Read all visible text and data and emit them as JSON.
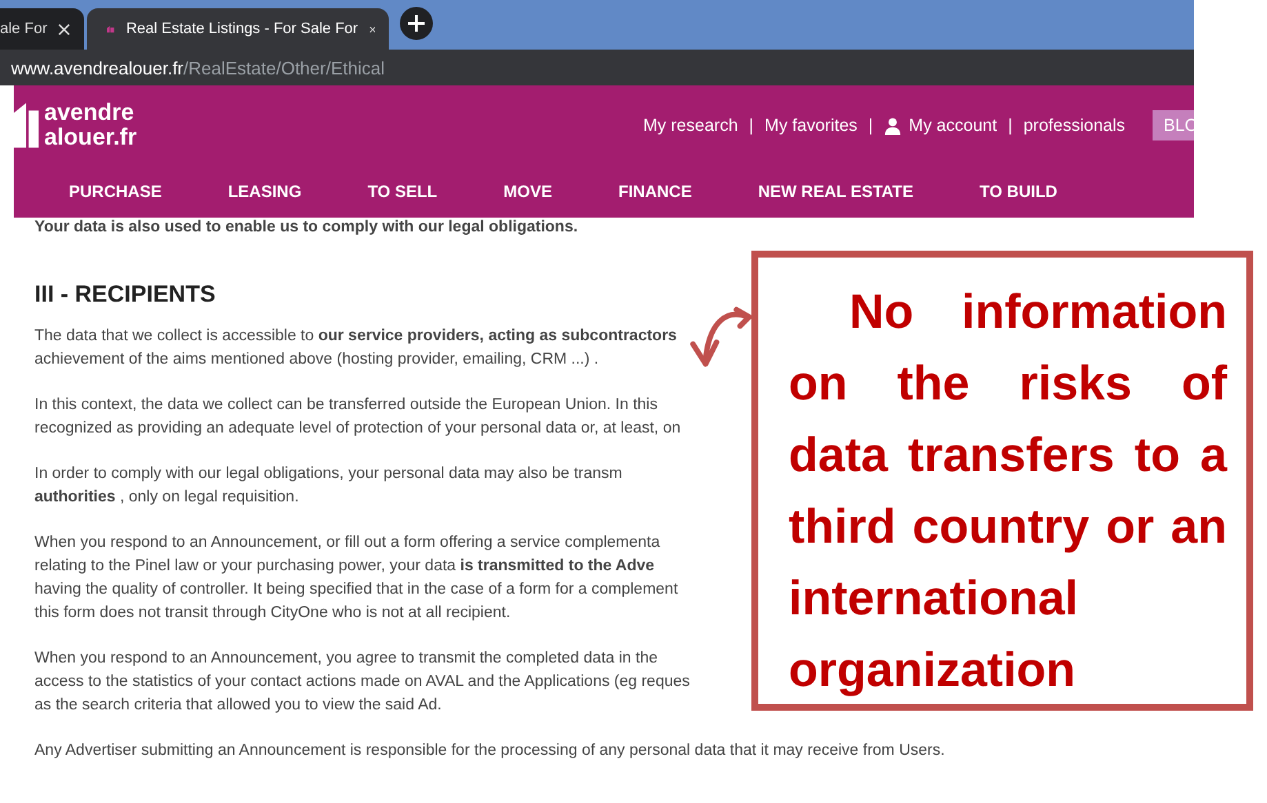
{
  "browser": {
    "tabs": [
      {
        "title": "ale For",
        "selected": false
      },
      {
        "title": "Real Estate Listings - For Sale For",
        "selected": true
      }
    ],
    "url": {
      "host": "www.avendrealouer.fr",
      "path": "/RealEstate/Other/Ethical"
    }
  },
  "header": {
    "logo": [
      "avendre",
      "alouer.fr"
    ],
    "links": [
      {
        "label": "My research",
        "kind": "link"
      },
      {
        "label": "|",
        "kind": "separator"
      },
      {
        "label": "My favorites",
        "kind": "link"
      },
      {
        "label": "|",
        "kind": "separator"
      },
      {
        "label": "My account",
        "kind": "account"
      },
      {
        "label": "|",
        "kind": "separator"
      },
      {
        "label": "professionals",
        "kind": "link"
      }
    ],
    "blog_button": "BLO",
    "nav": [
      "PURCHASE",
      "LEASING",
      "TO SELL",
      "MOVE",
      "FINANCE",
      "NEW REAL ESTATE",
      "TO BUILD"
    ]
  },
  "content": {
    "intro": "Your data is also used to enable us to comply with our legal obligations.",
    "heading": "III - RECIPIENTS",
    "paragraphs": [
      [
        "The data that we collect is accessible to **our service providers, acting as subcontractors**",
        "achievement of the aims mentioned above (hosting provider, emailing, CRM ...) ."
      ],
      [
        "In this context, the data we collect can be transferred outside the European Union. In this",
        "recognized as providing an adequate level of protection of your personal data or, at least, on"
      ],
      [
        "In order to comply with our legal obligations, your personal data may also be transm",
        "**authorities** , only on legal requisition."
      ],
      [
        "When you respond to an Announcement, or fill out a form offering a service complementa",
        "relating to the Pinel law or your purchasing power, your data **is transmitted to the Adve**",
        "having the quality of controller. It being specified that in the case of a form for a complement",
        "this form does not transit through CityOne who is not at all recipient."
      ],
      [
        "When you respond to an Announcement, you agree to transmit the completed data in the",
        "access to the statistics of your contact actions made on AVAL and the Applications (eg reques",
        "as the search criteria that allowed you to view the said Ad."
      ],
      [
        "Any Advertiser submitting an Announcement is responsible for the processing of any personal data that it may receive from Users."
      ]
    ]
  },
  "callout": {
    "text": "No information on the risks of data transfers to a third country or an international organization"
  }
}
